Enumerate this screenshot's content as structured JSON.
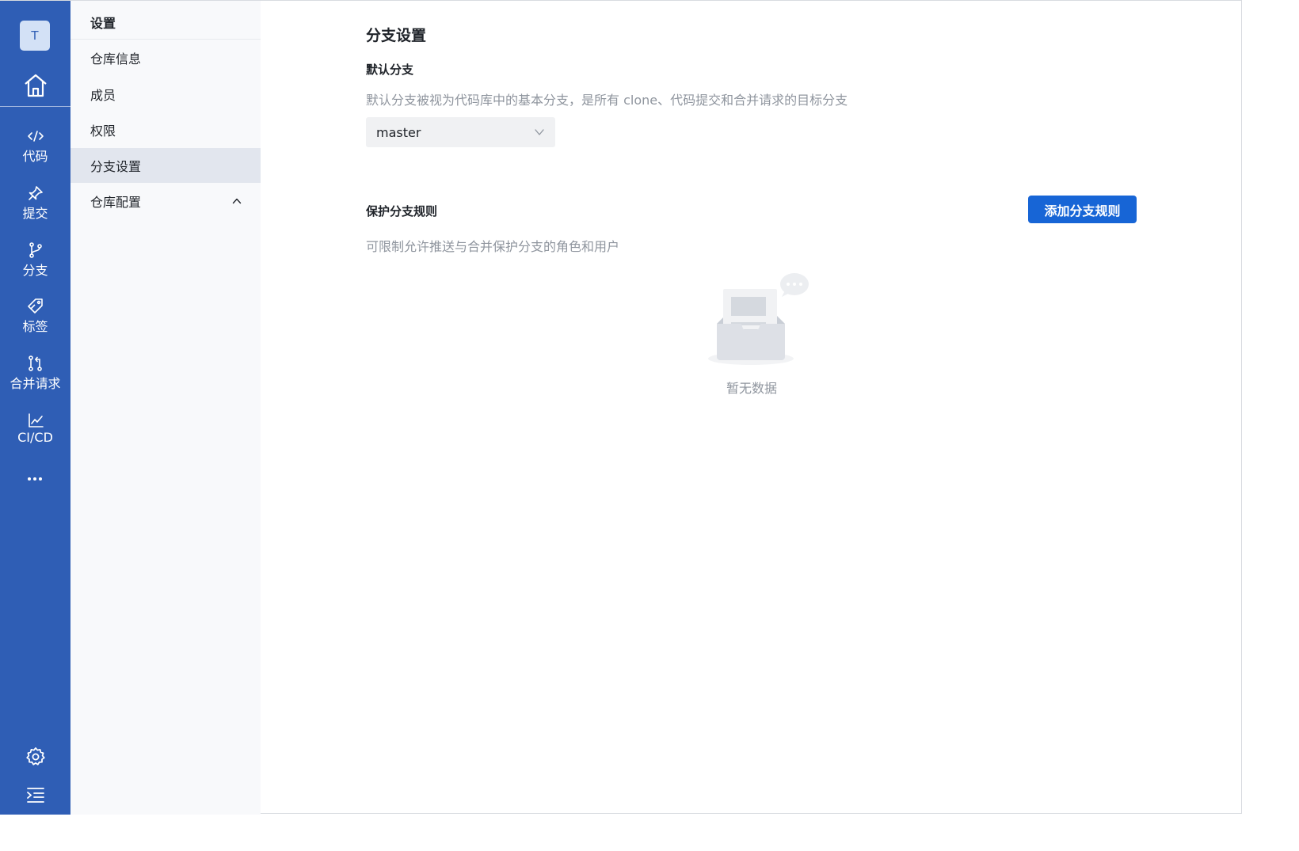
{
  "rail": {
    "avatar_letter": "T",
    "items": [
      {
        "label": "代码",
        "icon": "code-icon"
      },
      {
        "label": "提交",
        "icon": "pin-icon"
      },
      {
        "label": "分支",
        "icon": "branch-icon"
      },
      {
        "label": "标签",
        "icon": "tag-icon"
      },
      {
        "label": "合并请求",
        "icon": "merge-request-icon"
      },
      {
        "label": "CI/CD",
        "icon": "chart-icon"
      }
    ],
    "bg_color": "#2f5eb5"
  },
  "sidebar": {
    "title": "设置",
    "items": [
      {
        "label": "仓库信息"
      },
      {
        "label": "成员"
      },
      {
        "label": "权限"
      },
      {
        "label": "分支设置",
        "active": true
      },
      {
        "label": "仓库配置",
        "expandable": true
      }
    ]
  },
  "main": {
    "title": "分支设置",
    "default_branch": {
      "heading": "默认分支",
      "description": "默认分支被视为代码库中的基本分支，是所有 clone、代码提交和合并请求的目标分支",
      "selected": "master"
    },
    "protected": {
      "heading": "保护分支规则",
      "description": "可限制允许推送与合并保护分支的角色和用户",
      "add_button": "添加分支规则",
      "empty_text": "暂无数据"
    },
    "accent_color": "#1765d6"
  }
}
